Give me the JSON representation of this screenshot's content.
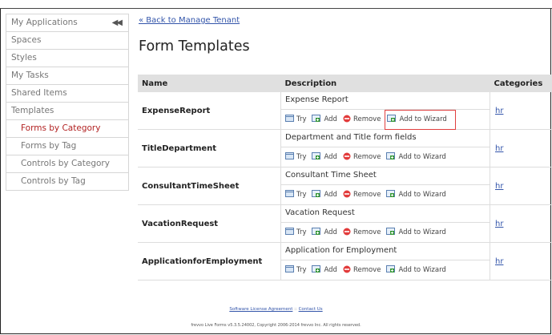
{
  "sidebar": {
    "collapse_glyph": "◀◀",
    "items": [
      {
        "label": "My Applications"
      },
      {
        "label": "Spaces"
      },
      {
        "label": "Styles"
      },
      {
        "label": "My Tasks"
      },
      {
        "label": "Shared Items"
      },
      {
        "label": "Templates"
      },
      {
        "label": "Forms by Category"
      },
      {
        "label": "Forms by Tag"
      },
      {
        "label": "Controls by Category"
      },
      {
        "label": "Controls by Tag"
      }
    ]
  },
  "main": {
    "back_link": "« Back to Manage Tenant",
    "title": "Form Templates",
    "columns": {
      "name": "Name",
      "description": "Description",
      "categories": "Categories"
    },
    "actions": {
      "try": "Try",
      "add": "Add",
      "remove": "Remove",
      "wizard": "Add to Wizard"
    },
    "rows": [
      {
        "name": "ExpenseReport",
        "description": "Expense Report",
        "category": "hr"
      },
      {
        "name": "TitleDepartment",
        "description": "Department and Title form fields",
        "category": "hr"
      },
      {
        "name": "ConsultantTimeSheet",
        "description": "Consultant Time Sheet",
        "category": "hr"
      },
      {
        "name": "VacationRequest",
        "description": "Vacation Request",
        "category": "hr"
      },
      {
        "name": "ApplicationforEmployment",
        "description": "Application for Employment",
        "category": "hr"
      }
    ]
  },
  "footer": {
    "license": "Software License Agreement",
    "separator": "::",
    "contact": "Contact Us",
    "copyright": "frevvo Live Forms v5.3.5.24002, Copyright 2006-2014 frevvo Inc. All rights reserved."
  },
  "colors": {
    "active_item": "#b22222",
    "link": "#3355aa",
    "highlight_box": "#e04040",
    "header_bg": "#e0e0e0"
  }
}
